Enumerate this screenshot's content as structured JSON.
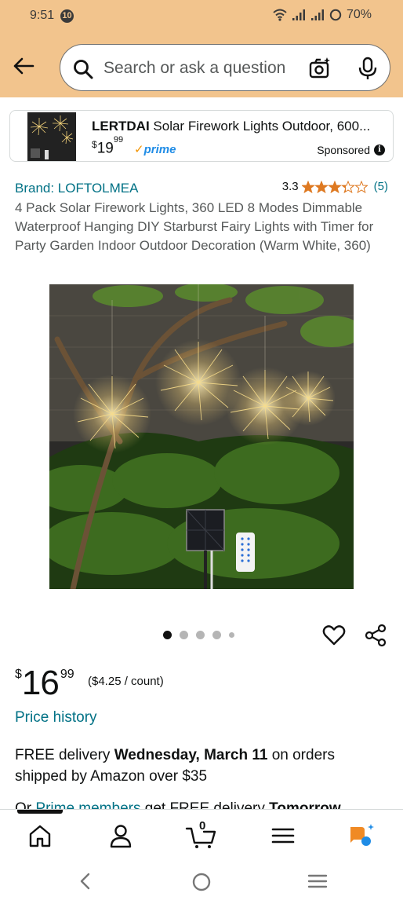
{
  "status_bar": {
    "time": "9:51",
    "notification_count": "10",
    "battery": "70%"
  },
  "search": {
    "placeholder": "Search or ask a question"
  },
  "ad": {
    "brand": "LERTDAI",
    "title": "Solar Firework Lights Outdoor, 600...",
    "price_currency": "$",
    "price_whole": "19",
    "price_fraction": "99",
    "prime_label": "prime",
    "sponsored_label": "Sponsored"
  },
  "product": {
    "brand_link": "Brand: LOFTOLMEA",
    "rating_value": "3.3",
    "rating_stars": 3.3,
    "rating_count": "(5)",
    "title": "4 Pack Solar Firework Lights, 360 LED 8 Modes Dimmable Waterproof Hanging DIY Starburst Fairy Lights with Timer for Party Garden Indoor Outdoor Decoration (Warm White, 360)",
    "image_count": 5,
    "active_image": 1
  },
  "price": {
    "currency": "$",
    "whole": "16",
    "fraction": "99",
    "unit_price": "($4.25 / count)",
    "history_link": "Price history"
  },
  "delivery": {
    "line1_prefix": "FREE delivery ",
    "line1_date": "Wednesday, March 11",
    "line1_suffix": " on orders shipped by Amazon over $35",
    "line2_prefix": "Or ",
    "line2_link": "Prime members",
    "line2_middle": " get FREE delivery ",
    "line2_date": "Tomorrow"
  },
  "bottom_nav": {
    "cart_count": "0"
  },
  "colors": {
    "header_bg": "#f2c48d",
    "link": "#007185",
    "star": "#de7921",
    "prime": "#1f8ce6"
  }
}
